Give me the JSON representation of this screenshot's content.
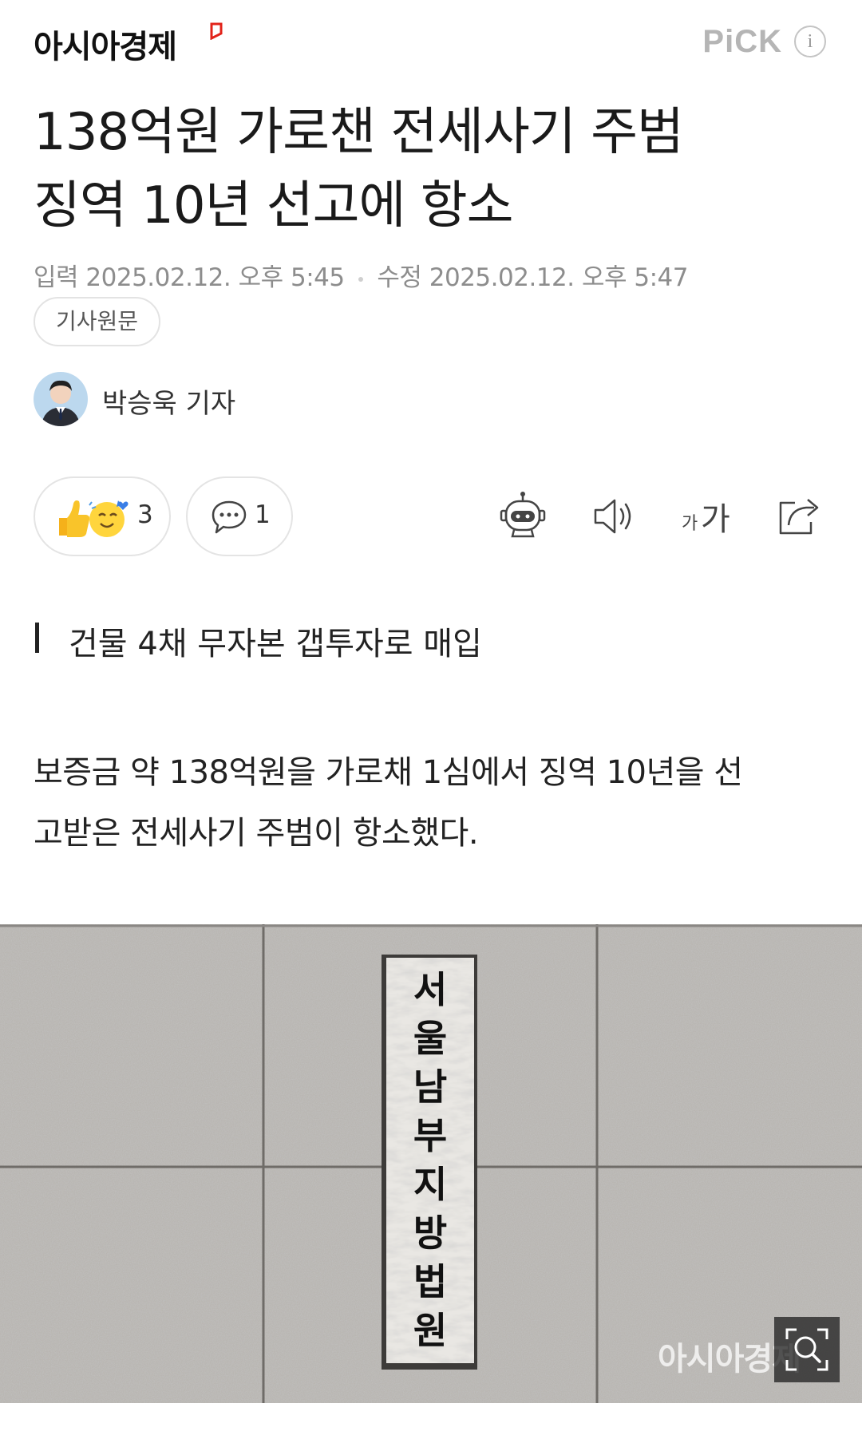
{
  "header": {
    "logo_text": "아시아경제",
    "pick_label": "PiCK",
    "info_label": "i"
  },
  "article": {
    "title_line1": "138억원 가로챈 전세사기 주범",
    "title_line2": "징역 10년 선고에 항소",
    "dates": {
      "input_label": "입력",
      "input_value": "2025.02.12. 오후 5:45",
      "modified_label": "수정",
      "modified_value": "2025.02.12. 오후 5:47"
    },
    "original_button": "기사원문",
    "author": "박승욱 기자",
    "reaction_count": "3",
    "comment_count": "1",
    "subheading": "건물 4채 무자본 갭투자로 매입",
    "body_line1": "보증금 약 138억원을 가로채 1심에서 징역 10년을 선",
    "body_line2": "고받은 전세사기 주범이 항소했다."
  },
  "toolbar": {
    "font_size_small": "가",
    "font_size_large": "가"
  },
  "photo": {
    "sign_chars": [
      "서",
      "울",
      "남",
      "부",
      "지",
      "방",
      "법",
      "원"
    ],
    "watermark": "아시아경제"
  },
  "icons": {
    "reaction": "thumbs-up-and-smile-icon",
    "comment": "speech-bubble-icon",
    "summary_bot": "robot-icon",
    "tts": "speaker-icon",
    "font_size": "font-size-icon",
    "share": "share-icon",
    "zoom": "image-zoom-icon"
  },
  "colors": {
    "brand_red": "#e2231a",
    "muted_text": "#8d8d8d",
    "pick_gray": "#b5b5b5"
  }
}
